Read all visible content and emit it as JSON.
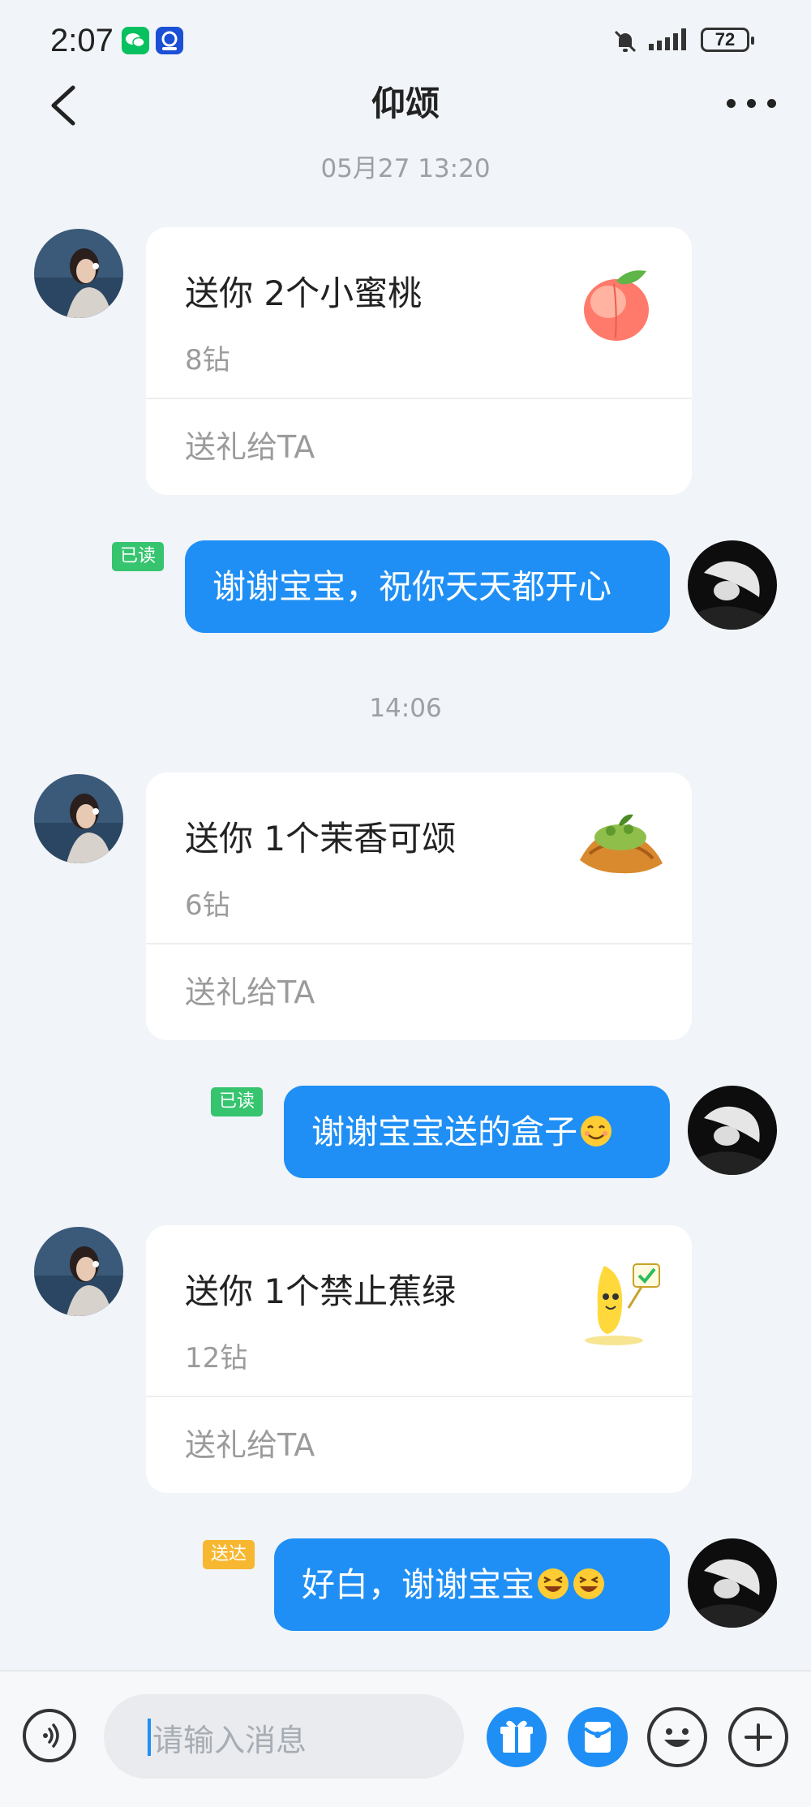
{
  "status_bar": {
    "time": "2:07",
    "battery": "72",
    "icons": [
      "wechat-icon",
      "qq-app-icon",
      "mute-icon",
      "signal-icon",
      "battery-icon"
    ]
  },
  "header": {
    "title": "仰颂",
    "back_icon": "chevron-left-icon",
    "more_icon": "more-icon"
  },
  "messages": {
    "ts1": "05月27 13:20",
    "ts2": "14:06",
    "gift1": {
      "name": "送你 2个小蜜桃",
      "price": "8钻",
      "action": "送礼给TA",
      "image": "peach-icon"
    },
    "reply1": {
      "text": "谢谢宝宝，祝你天天都开心",
      "status": "已读"
    },
    "gift2": {
      "name": "送你 1个茉香可颂",
      "price": "6钻",
      "action": "送礼给TA",
      "image": "croissant-icon"
    },
    "reply2": {
      "text": "谢谢宝宝送的盒子",
      "status": "已读",
      "emoji": "smiling-face"
    },
    "gift3": {
      "name": "送你 1个禁止蕉绿",
      "price": "12钻",
      "action": "送礼给TA",
      "image": "banana-icon"
    },
    "reply3": {
      "text": "好白，谢谢宝宝",
      "status": "送达",
      "emoji": "laughing-face"
    }
  },
  "input_bar": {
    "placeholder": "请输入消息",
    "icons": [
      "voice-icon",
      "gift-icon",
      "red-packet-icon",
      "emoji-icon",
      "plus-icon"
    ]
  },
  "colors": {
    "background": "#f1f4f8",
    "bubble": "#1f8ff5",
    "read_tag": "#36c46f",
    "sent_tag": "#f7b731"
  }
}
